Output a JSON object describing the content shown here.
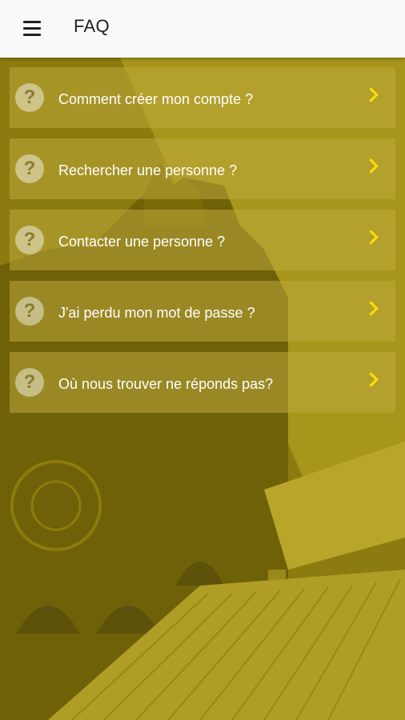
{
  "appbar": {
    "title": "FAQ",
    "menu_icon": "hamburger-menu-icon"
  },
  "colors": {
    "accent": "#ffe100",
    "overlay": "#8a7a10",
    "appbar_bg": "#fafafa"
  },
  "faq": {
    "items": [
      {
        "label": "Comment créer mon compte ?",
        "icon": "question-circle-icon"
      },
      {
        "label": "Rechercher une personne ?",
        "icon": "question-circle-icon"
      },
      {
        "label": "Contacter une personne ?",
        "icon": "question-circle-icon"
      },
      {
        "label": "J'ai perdu mon mot de passe ?",
        "icon": "question-circle-icon"
      },
      {
        "label": "Où nous trouver ne réponds pas?",
        "icon": "question-circle-icon"
      }
    ],
    "chevron_icon": "chevron-right-icon"
  }
}
